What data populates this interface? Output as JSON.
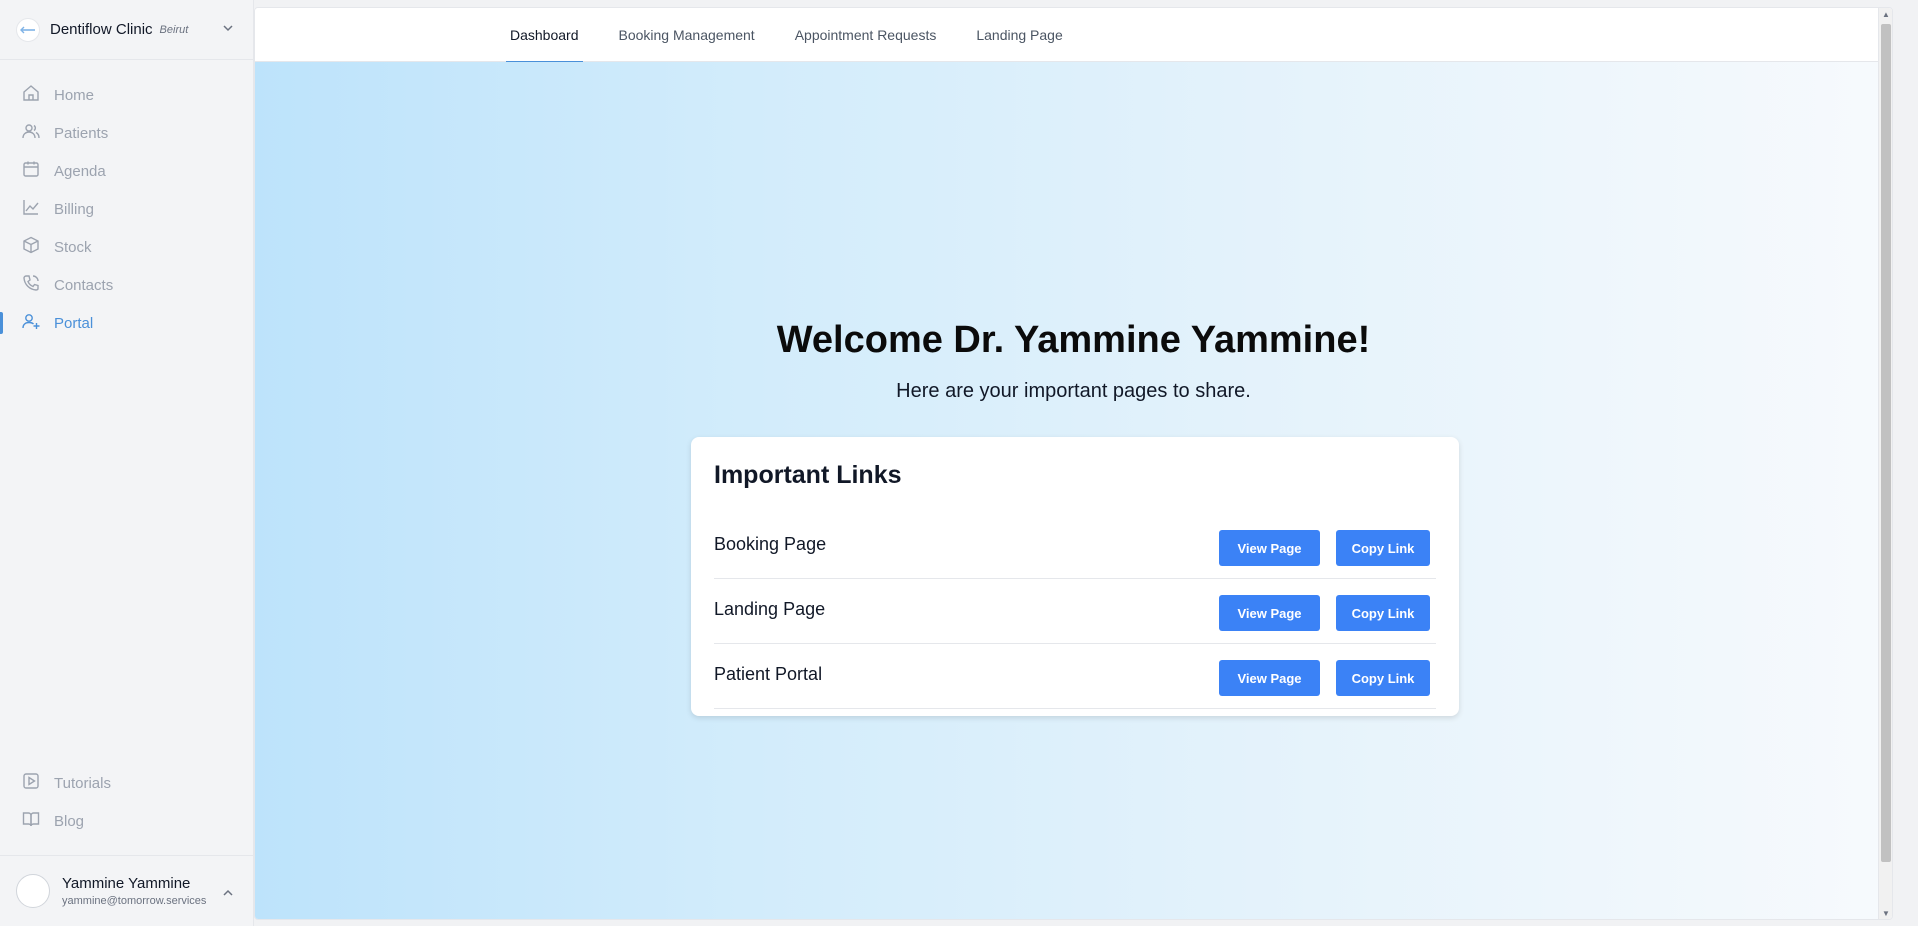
{
  "clinic": {
    "name": "Dentiflow Clinic",
    "city": "Beirut"
  },
  "sidebar": {
    "items": [
      {
        "label": "Home",
        "icon": "home-icon",
        "active": false
      },
      {
        "label": "Patients",
        "icon": "users-icon",
        "active": false
      },
      {
        "label": "Agenda",
        "icon": "calendar-icon",
        "active": false
      },
      {
        "label": "Billing",
        "icon": "chart-line-icon",
        "active": false
      },
      {
        "label": "Stock",
        "icon": "box-icon",
        "active": false
      },
      {
        "label": "Contacts",
        "icon": "phone-icon",
        "active": false
      },
      {
        "label": "Portal",
        "icon": "user-plus-icon",
        "active": true
      }
    ],
    "bottom_items": [
      {
        "label": "Tutorials",
        "icon": "play-icon"
      },
      {
        "label": "Blog",
        "icon": "book-icon"
      }
    ]
  },
  "user": {
    "name": "Yammine Yammine",
    "email": "yammine@tomorrow.services"
  },
  "tabs": [
    {
      "label": "Dashboard",
      "active": true
    },
    {
      "label": "Booking Management",
      "active": false
    },
    {
      "label": "Appointment Requests",
      "active": false
    },
    {
      "label": "Landing Page",
      "active": false
    }
  ],
  "welcome": {
    "title": "Welcome Dr. Yammine Yammine!",
    "subtitle": "Here are your important pages to share."
  },
  "links_card": {
    "title": "Important Links",
    "rows": [
      {
        "label": "Booking Page",
        "view_label": "View Page",
        "copy_label": "Copy Link"
      },
      {
        "label": "Landing Page",
        "view_label": "View Page",
        "copy_label": "Copy Link"
      },
      {
        "label": "Patient Portal",
        "view_label": "View Page",
        "copy_label": "Copy Link"
      }
    ]
  },
  "colors": {
    "accent": "#4a90d9",
    "button": "#3b82f6",
    "gradient_start": "#bde3fb",
    "gradient_end": "#f7fafd"
  }
}
